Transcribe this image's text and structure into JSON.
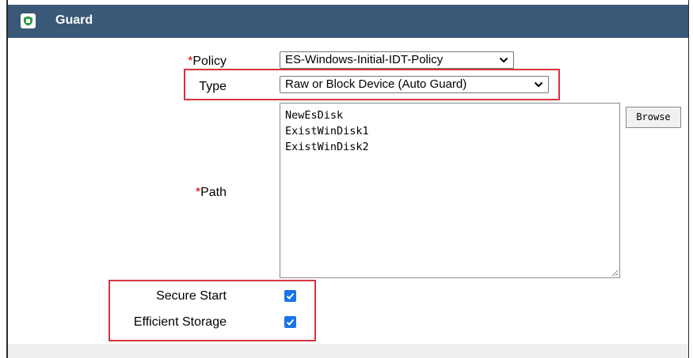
{
  "panel": {
    "title": "Guard",
    "icon": "shield-icon",
    "header_color": "#3a5877"
  },
  "form": {
    "required_marker": "*",
    "policy": {
      "label": "Policy",
      "required": true,
      "selected": "ES-Windows-Initial-IDT-Policy"
    },
    "type": {
      "label": "Type",
      "required": false,
      "selected": "Raw or Block Device (Auto Guard)"
    },
    "path": {
      "label": "Path",
      "required": true,
      "value": "NewEsDisk\nExistWinDisk1\nExistWinDisk2",
      "browse_label": "Browse"
    },
    "secure_start": {
      "label": "Secure Start",
      "checked": true
    },
    "efficient_storage": {
      "label": "Efficient Storage",
      "checked": true
    }
  },
  "colors": {
    "highlight": "#d9333f",
    "checkbox": "#1a73e8",
    "required": "#cc0000"
  }
}
